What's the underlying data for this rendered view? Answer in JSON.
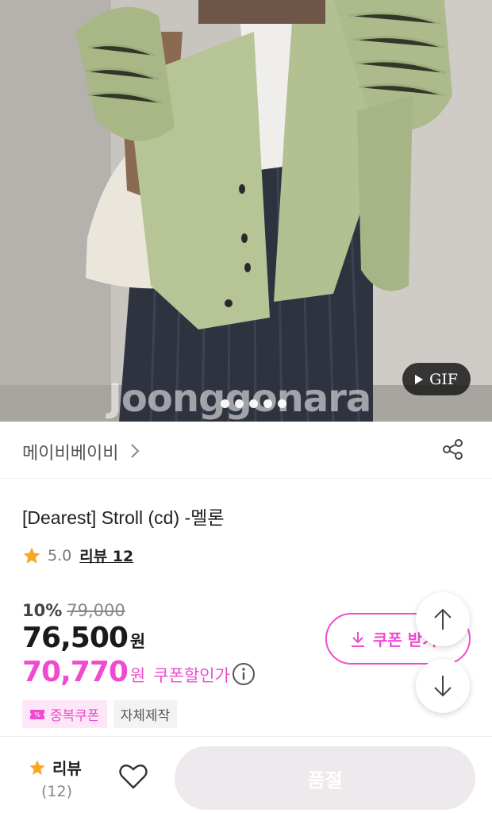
{
  "hero": {
    "gif_label": "GIF",
    "watermark": "Joonggonara",
    "slide_count": 5
  },
  "store": {
    "name": "메이비베이비"
  },
  "product": {
    "title": "[Dearest] Stroll (cd) -멜론",
    "rating": "5.0",
    "review_link": "리뷰 12"
  },
  "pricing": {
    "discount_rate": "10%",
    "original_price": "79,000",
    "price": "76,500",
    "price_unit": "원",
    "coupon_price": "70,770",
    "coupon_unit": "원",
    "coupon_label": "쿠폰할인가",
    "coupon_button": "쿠폰 받기"
  },
  "tags": {
    "dup_coupon": "중복쿠폰",
    "self_made": "자체제작"
  },
  "bottom_bar": {
    "review_label": "리뷰",
    "review_count": "(12)",
    "cta_label": "품절"
  },
  "colors": {
    "accent": "#f04bd0",
    "star": "#f7a823",
    "soldout_bg": "#ede9ec"
  }
}
